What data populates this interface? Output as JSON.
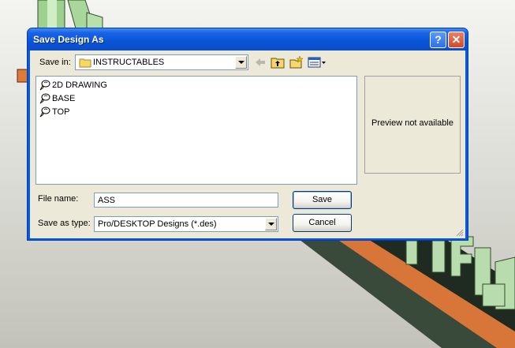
{
  "window": {
    "title": "Save Design As",
    "help_glyph": "?",
    "close_glyph": "✕"
  },
  "save_in": {
    "label": "Save in:",
    "value": "INSTRUCTABLES"
  },
  "toolbar": {
    "icons": [
      "back-arrow-icon",
      "up-folder-icon",
      "new-folder-icon",
      "view-menu-icon"
    ]
  },
  "files": [
    {
      "name": "2D DRAWING",
      "icon": "design-file-icon"
    },
    {
      "name": "BASE",
      "icon": "design-file-icon"
    },
    {
      "name": "TOP",
      "icon": "design-file-icon"
    }
  ],
  "preview": {
    "text": "Preview not available"
  },
  "file_name": {
    "label": "File name:",
    "value": "ASS"
  },
  "save_as_type": {
    "label": "Save as type:",
    "value": "Pro/DESKTOP Designs (*.des)"
  },
  "buttons": {
    "save": "Save",
    "cancel": "Cancel"
  },
  "colors": {
    "titlebar": "#0a54d6",
    "dialog_bg": "#ece9d8",
    "scene_green": "#b9dcae",
    "scene_orange": "#e07a3a"
  }
}
